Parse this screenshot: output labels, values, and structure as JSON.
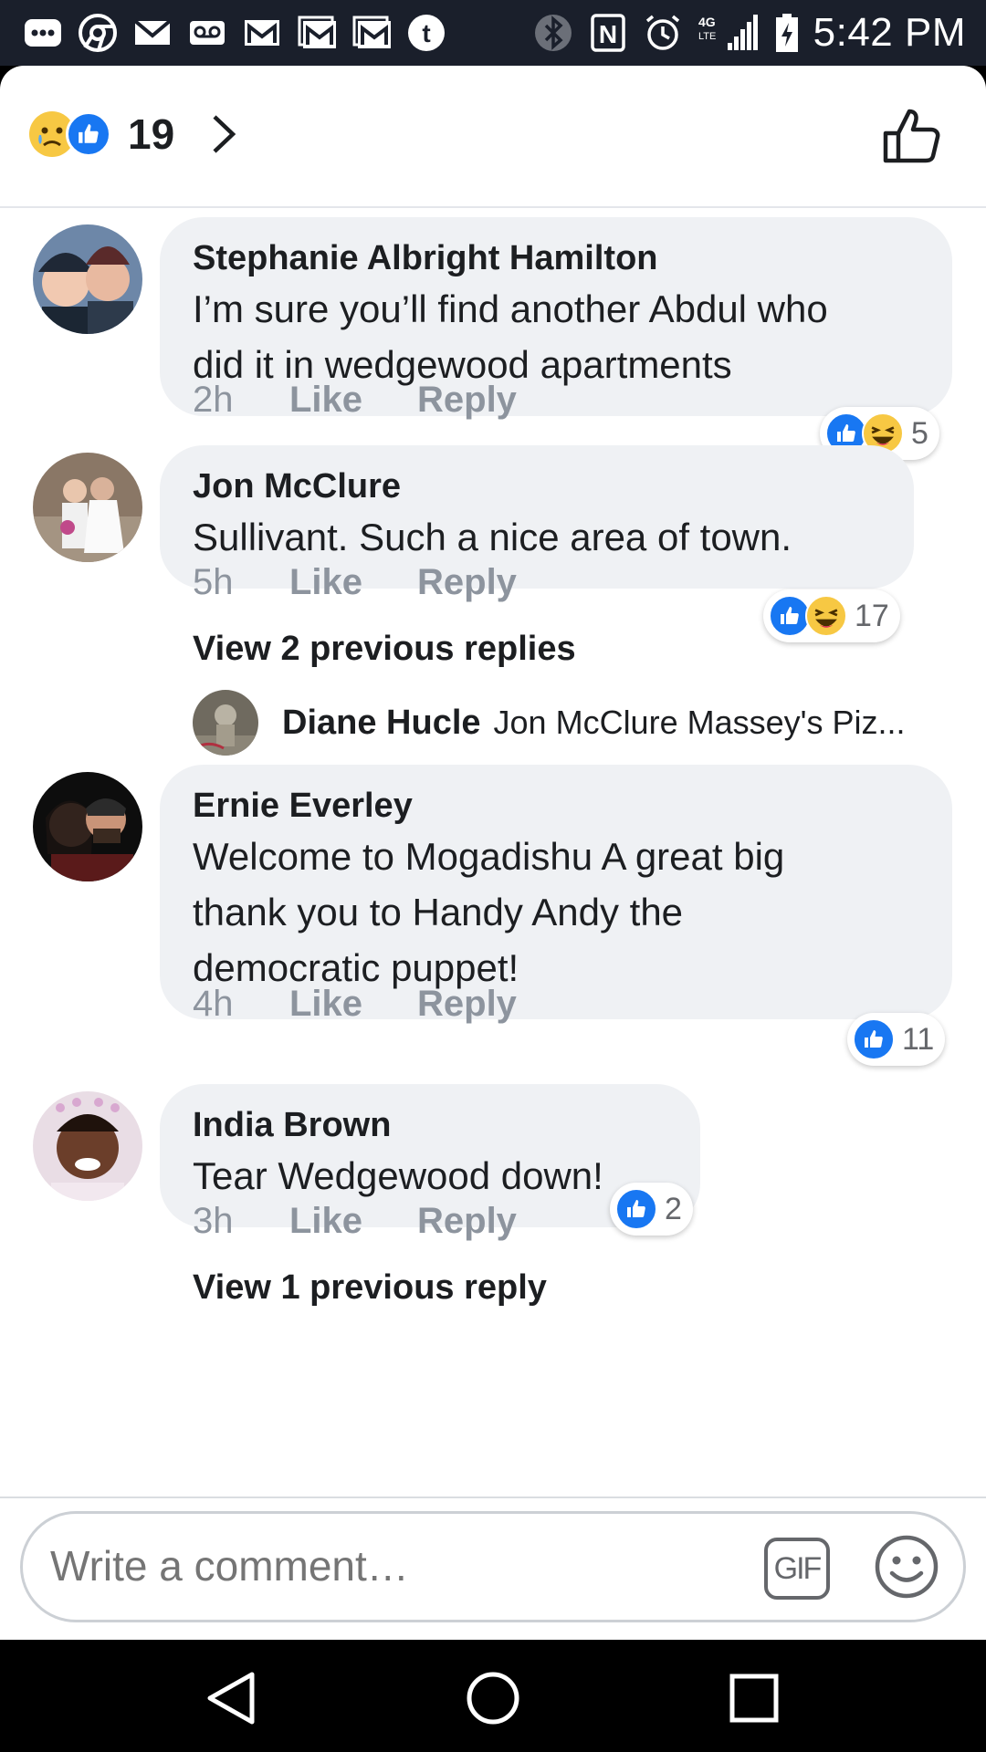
{
  "status_bar": {
    "time": "5:42 PM",
    "network": "4G LTE",
    "left_icons": [
      "more-icon",
      "chrome-icon",
      "mail-icon",
      "voicemail-icon",
      "gmail-icon",
      "gmail-icon",
      "gmail-icon",
      "tumblr-icon"
    ],
    "right_icons": [
      "bluetooth-icon",
      "nfc-icon",
      "alarm-icon",
      "signal-icon",
      "battery-charging-icon"
    ]
  },
  "header": {
    "reaction_count": "19",
    "reaction_icons": [
      "sad-emoji-icon",
      "like-reaction-icon"
    ]
  },
  "comments": [
    {
      "name": "Stephanie Albright Hamilton",
      "text_lines": [
        "I’m sure you’ll find another Abdul who",
        "did it in wedgewood apartments"
      ],
      "time": "2h",
      "like_label": "Like",
      "reply_label": "Reply",
      "reactions": [
        "like",
        "haha"
      ],
      "reaction_count": "5"
    },
    {
      "name": "Jon McClure",
      "text_lines": [
        "Sullivant. Such a nice area of town."
      ],
      "time": "5h",
      "like_label": "Like",
      "reply_label": "Reply",
      "reactions": [
        "like",
        "haha"
      ],
      "reaction_count": "17",
      "view_replies": "View 2 previous replies",
      "reply_preview": {
        "name": "Diane Hucle",
        "text": "Jon McClure Massey's Piz..."
      }
    },
    {
      "name": "Ernie Everley",
      "text_lines": [
        "Welcome to Mogadishu A great big",
        "thank you to Handy Andy the",
        "democratic puppet!"
      ],
      "time": "4h",
      "like_label": "Like",
      "reply_label": "Reply",
      "reactions": [
        "like"
      ],
      "reaction_count": "11"
    },
    {
      "name": "India Brown",
      "text_lines": [
        "Tear Wedgewood down!"
      ],
      "time": "3h",
      "like_label": "Like",
      "reply_label": "Reply",
      "reactions": [
        "like"
      ],
      "reaction_count": "2",
      "view_replies": "View 1 previous reply"
    }
  ],
  "composer": {
    "placeholder": "Write a comment…",
    "gif_label": "GIF"
  },
  "colors": {
    "status_bar_bg": "#1a1f2b",
    "like_blue": "#1877f2",
    "bubble_bg": "#eff1f4",
    "muted_text": "#8d949e",
    "emoji_yellow": "#f7c843"
  }
}
